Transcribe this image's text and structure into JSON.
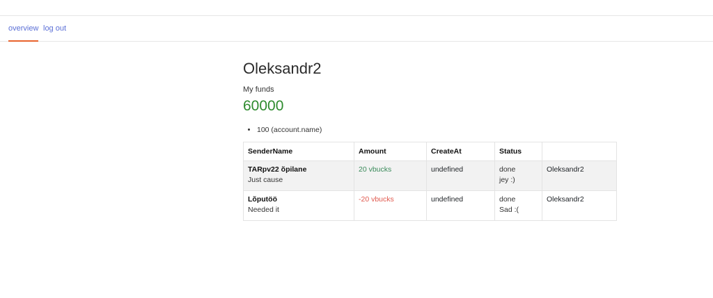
{
  "nav": {
    "overview_label": "overview",
    "logout_label": "log out",
    "accent_color": "#e8622c",
    "link_color": "#5b6fd6"
  },
  "profile": {
    "username": "Oleksandr2",
    "funds_label": "My funds",
    "funds_value": "60000",
    "funds_color": "#2e8b2e"
  },
  "accounts": [
    {
      "text": "100 (account.name)"
    }
  ],
  "table": {
    "headers": [
      "SenderName",
      "Amount",
      "CreateAt",
      "Status",
      ""
    ],
    "rows": [
      {
        "sender_name": "TARpv22 õpilane",
        "reason": "Just cause",
        "amount": "20 vbucks",
        "amount_sign": "positive",
        "created_at": "undefined",
        "status": "done",
        "status_note": "jey :)",
        "receiver": "Oleksandr2"
      },
      {
        "sender_name": "Lõputöö",
        "reason": "Needed it",
        "amount": "-20 vbucks",
        "amount_sign": "negative",
        "created_at": "undefined",
        "status": "done",
        "status_note": "Sad :(",
        "receiver": "Oleksandr2"
      }
    ]
  }
}
